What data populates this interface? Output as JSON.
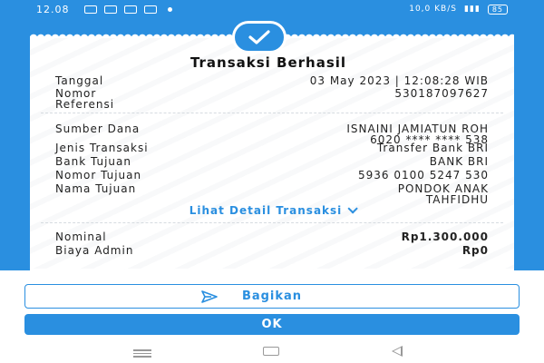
{
  "status_bar": {
    "time": "12.08",
    "right_text": "10,0 KB/S",
    "battery": "85"
  },
  "receipt": {
    "title": "Transaksi Berhasil",
    "rows_top": [
      {
        "label": "Tanggal",
        "value": "03 May 2023 | 12:08:28 WIB"
      },
      {
        "label": "Nomor\nReferensi",
        "value": "530187097627"
      }
    ],
    "rows_mid": [
      {
        "label": "Sumber Dana",
        "value": "ISNAINI JAMIATUN ROH\n6020 **** **** 538"
      },
      {
        "label": "Jenis Transaksi",
        "value": "Transfer Bank BRI"
      },
      {
        "label": "Bank Tujuan",
        "value": "BANK BRI"
      },
      {
        "label": "Nomor Tujuan",
        "value": "5936 0100 5247 530"
      },
      {
        "label": "Nama Tujuan",
        "value": "PONDOK ANAK\nTAHFIDHU"
      }
    ],
    "detail_link": "Lihat Detail Transaksi",
    "rows_bottom": [
      {
        "label": "Nominal",
        "value": "Rp1.300.000"
      },
      {
        "label": "Biaya Admin",
        "value": "Rp0"
      }
    ]
  },
  "actions": {
    "share_label": "Bagikan",
    "ok_label": "OK"
  },
  "colors": {
    "primary": "#2a8fe0",
    "background": "#ffffff",
    "text": "#222222"
  }
}
